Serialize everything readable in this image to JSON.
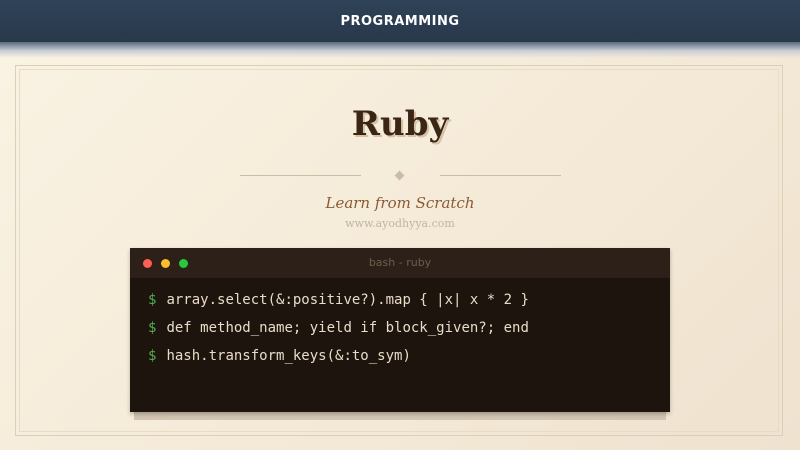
{
  "header": {
    "category": "PROGRAMMING"
  },
  "slide": {
    "title": "Ruby",
    "subtitle": "Learn from Scratch",
    "website": "www.ayodhyya.com"
  },
  "terminal": {
    "window_title": "bash - ruby",
    "prompt_symbol": "$",
    "lines": [
      "array.select(&:positive?).map { |x| x * 2 }",
      "def method_name; yield if block_given?; end",
      "hash.transform_keys(&:to_sym)"
    ],
    "dot_colors": {
      "close": "#ff5f56",
      "minimize": "#ffbd2e",
      "maximize": "#27c93f"
    }
  }
}
